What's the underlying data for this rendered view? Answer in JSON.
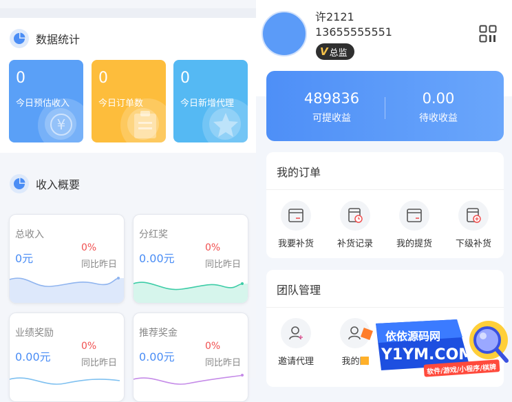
{
  "data_stats": {
    "title": "数据统计",
    "cards": [
      {
        "value": "0",
        "label": "今日预估收入",
        "color": "#5aa0f7"
      },
      {
        "value": "0",
        "label": "今日订单数",
        "color": "#fdbd3c"
      },
      {
        "value": "0",
        "label": "今日新增代理",
        "color": "#55b9f3"
      }
    ]
  },
  "income_overview": {
    "title": "收入概要",
    "cards": [
      {
        "title": "总收入",
        "value": "0元",
        "pct": "0%",
        "compare": "同比昨日",
        "line_color": "#8fb4ef"
      },
      {
        "title": "分红奖",
        "value": "0.00元",
        "pct": "0%",
        "compare": "同比昨日",
        "line_color": "#3ccca6"
      },
      {
        "title": "业绩奖励",
        "value": "0.00元",
        "pct": "0%",
        "compare": "同比昨日",
        "line_color": "#7ec0f0"
      },
      {
        "title": "推荐奖金",
        "value": "0.00元",
        "pct": "0%",
        "compare": "同比昨日",
        "line_color": "#c58be8"
      }
    ]
  },
  "profile": {
    "name": "许2121",
    "phone": "13655555551",
    "badge": "总监",
    "badge_mark": "V"
  },
  "earnings": {
    "withdrawable_value": "489836",
    "withdrawable_label": "可提收益",
    "pending_value": "0.00",
    "pending_label": "待收收益"
  },
  "my_orders": {
    "title": "我的订单",
    "items": [
      {
        "label": "我要补货",
        "icon": "restock-icon"
      },
      {
        "label": "补货记录",
        "icon": "restock-record-icon"
      },
      {
        "label": "我的提货",
        "icon": "pickup-icon"
      },
      {
        "label": "下级补货",
        "icon": "sub-restock-icon"
      }
    ]
  },
  "team": {
    "title": "团队管理",
    "items": [
      {
        "label": "邀请代理",
        "icon": "invite-agent-icon"
      },
      {
        "label": "我的团",
        "icon": "my-team-icon"
      }
    ]
  },
  "watermark": {
    "line1": "依依源码网",
    "line2": "Y1YM.COM",
    "line3": "软件/游戏/小程序/棋牌"
  }
}
